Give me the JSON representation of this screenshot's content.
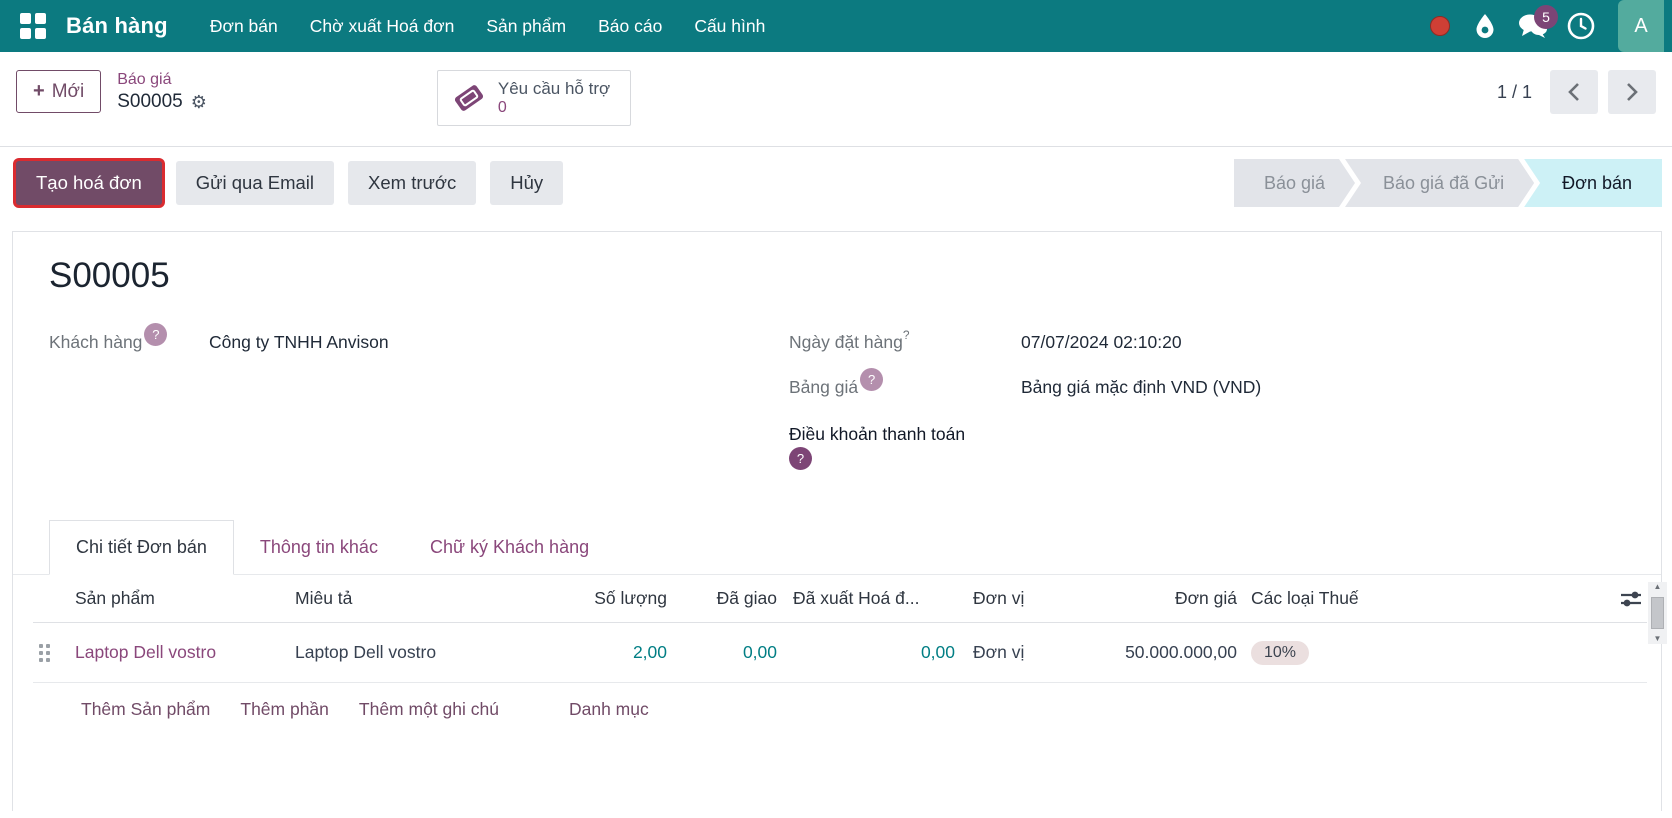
{
  "navbar": {
    "app_name": "Bán hàng",
    "menus": [
      "Đơn bán",
      "Chờ xuất Hoá đơn",
      "Sản phẩm",
      "Báo cáo",
      "Cấu hình"
    ],
    "message_badge": "5",
    "avatar_letter": "A"
  },
  "control_panel": {
    "new_button_label": "Mới",
    "new_button_plus": "+",
    "breadcrumb_parent": "Báo giá",
    "breadcrumb_current": "S00005",
    "support_label": "Yêu cầu hỗ trợ",
    "support_count": "0",
    "pager_value": "1 / 1"
  },
  "action_bar": {
    "primary_button": "Tạo hoá đơn",
    "secondary_buttons": [
      "Gửi qua Email",
      "Xem trước",
      "Hủy"
    ]
  },
  "statusbar": {
    "steps": [
      {
        "label": "Báo giá",
        "active": false
      },
      {
        "label": "Báo giá đã Gửi",
        "active": false
      },
      {
        "label": "Đơn bán",
        "active": true
      }
    ]
  },
  "form": {
    "title": "S00005",
    "customer_label": "Khách hàng",
    "customer_value": "Công ty TNHH Anvison",
    "order_date_label": "Ngày đặt hàng",
    "order_date_help": "?",
    "order_date_value": "07/07/2024 02:10:20",
    "pricelist_label": "Bảng giá",
    "pricelist_value": "Bảng giá mặc định VND (VND)",
    "payment_terms_label": "Điều khoản thanh toán",
    "help_badge": "?"
  },
  "tabs": [
    "Chi tiết Đơn bán",
    "Thông tin khác",
    "Chữ ký Khách hàng"
  ],
  "order_lines": {
    "headers": {
      "product": "Sản phẩm",
      "description": "Miêu tả",
      "quantity": "Số lượng",
      "delivered": "Đã giao",
      "invoiced": "Đã xuất Hoá đ...",
      "unit": "Đơn vị",
      "unit_price": "Đơn giá",
      "taxes": "Các loại Thuế"
    },
    "rows": [
      {
        "product": "Laptop Dell vostro",
        "description": "Laptop Dell vostro",
        "quantity": "2,00",
        "delivered": "0,00",
        "invoiced": "0,00",
        "unit": "Đơn vị",
        "unit_price": "50.000.000,00",
        "tax": "10%"
      }
    ],
    "footer_links": [
      "Thêm Sản phẩm",
      "Thêm phần",
      "Thêm một ghi chú",
      "Danh mục"
    ]
  },
  "colors": {
    "navbar_teal": "#0c7a80",
    "primary_purple": "#714b67",
    "link_purple": "#8a477b",
    "numeric_teal": "#017e84",
    "highlight_red": "#da2b30",
    "status_active_bg": "#cdf1f6",
    "badge_purple": "#7c4576"
  }
}
